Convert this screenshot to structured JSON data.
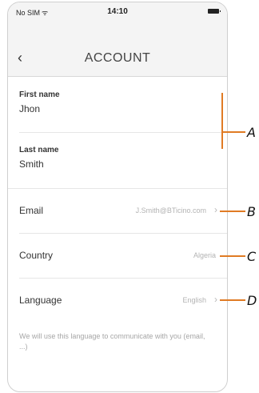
{
  "status_bar": {
    "carrier": "No SIM",
    "carrier_icon": "wifi-icon",
    "time": "14:10",
    "battery_icon": "battery-icon"
  },
  "nav": {
    "title": "ACCOUNT",
    "back_icon": "chevron-left-icon"
  },
  "profile": {
    "first_name_label": "First name",
    "first_name_value": "Jhon",
    "last_name_label": "Last name",
    "last_name_value": "Smith"
  },
  "rows": [
    {
      "label": "Email",
      "value": "J.Smith@BTicino.com"
    },
    {
      "label": "Country",
      "value": "Algeria"
    },
    {
      "label": "Language",
      "value": "English"
    }
  ],
  "help_text": "We will use this language to communicate with you (email, ...)",
  "annotations": {
    "a": "A",
    "b": "B",
    "c": "C",
    "d": "D"
  },
  "colors": {
    "accent": "#e07b24",
    "nav_bg": "#f4f4f4",
    "muted": "#b3b3b3"
  }
}
